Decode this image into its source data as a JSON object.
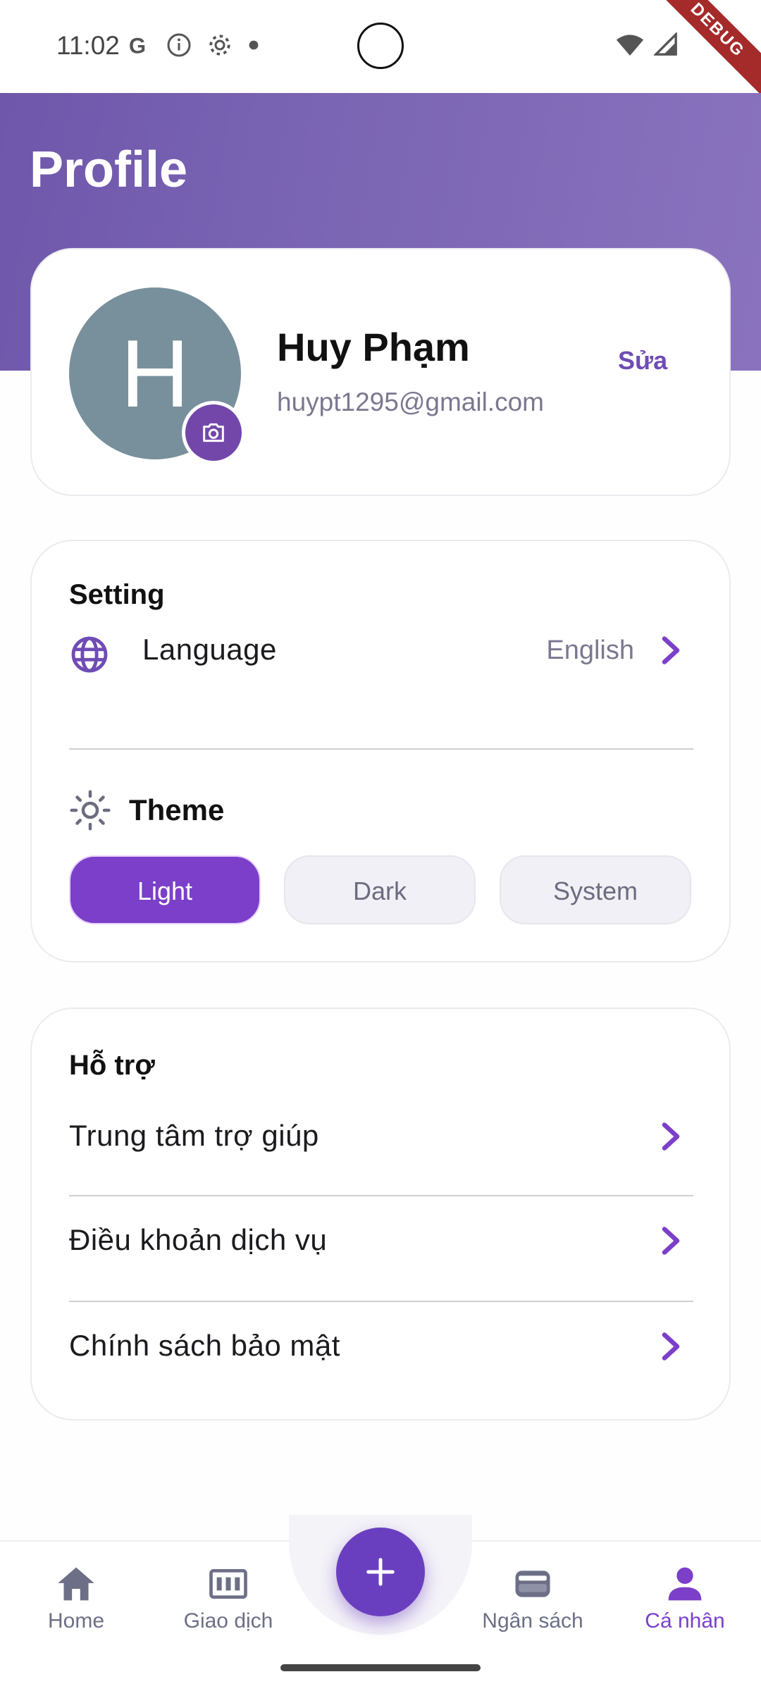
{
  "status_bar": {
    "time": "11:02",
    "icons_left": [
      "google-icon",
      "info-icon",
      "settings-icon",
      "dot-icon"
    ],
    "icons_right": [
      "wifi-icon",
      "signal-icon"
    ],
    "debug_label": "DEBUG"
  },
  "header": {
    "title": "Profile"
  },
  "profile": {
    "avatar_initial": "H",
    "name": "Huy Phạm",
    "email": "huypt1295@gmail.com",
    "edit_label": "Sửa",
    "avatar_color": "#78909c"
  },
  "settings": {
    "title": "Setting",
    "language_label": "Language",
    "language_value": "English",
    "theme_label": "Theme",
    "theme_options": [
      "Light",
      "Dark",
      "System"
    ],
    "theme_selected": "Light"
  },
  "support": {
    "title": "Hỗ trợ",
    "items": [
      "Trung tâm trợ giúp",
      "Điều khoản dịch vụ",
      "Chính sách bảo mật"
    ]
  },
  "bottom_nav": {
    "items": [
      {
        "label": "Home",
        "icon": "home-icon"
      },
      {
        "label": "Giao dịch",
        "icon": "transactions-icon"
      },
      {
        "label": "Ngân sách",
        "icon": "wallet-icon"
      },
      {
        "label": "Cá nhân",
        "icon": "person-icon"
      }
    ],
    "active": "Cá nhân",
    "fab_icon": "plus-icon"
  },
  "colors": {
    "accent": "#7b3fc9",
    "header_gradient_start": "#6f57ab",
    "header_gradient_end": "#8a72be",
    "muted_text": "#7a7890"
  }
}
